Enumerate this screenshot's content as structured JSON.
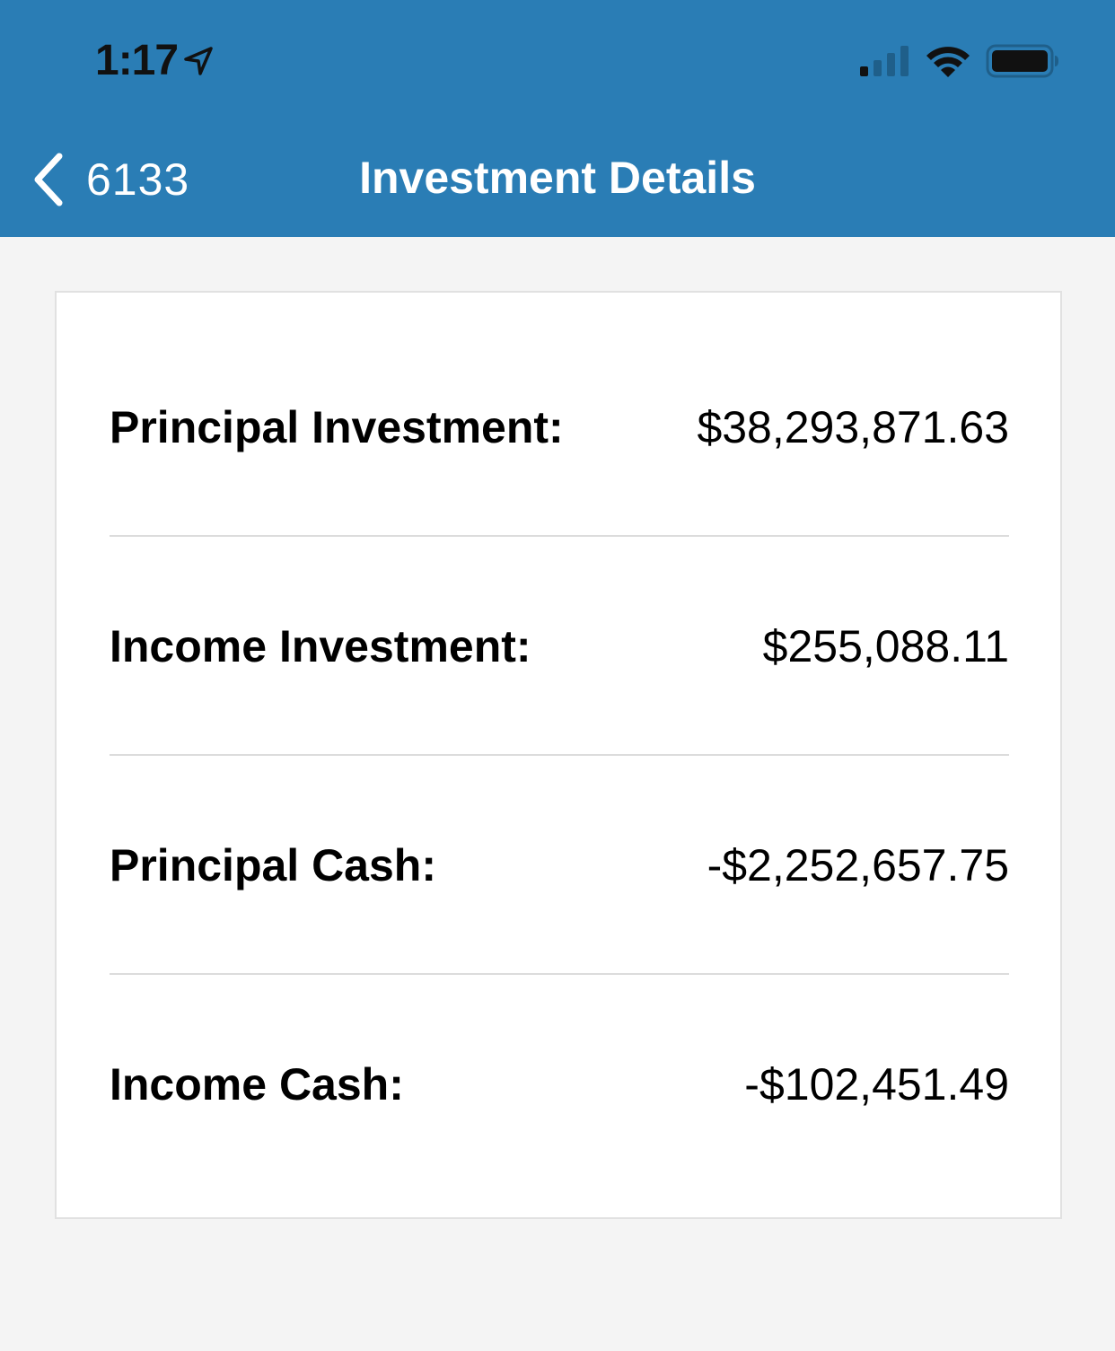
{
  "status_bar": {
    "time": "1:17",
    "icons": [
      "location-arrow-icon",
      "cellular-signal-icon",
      "wifi-icon",
      "battery-icon"
    ]
  },
  "nav": {
    "back_label": "6133",
    "title": "Investment Details",
    "background_color": "#2a7db5"
  },
  "details": [
    {
      "label": "Principal Investment:",
      "value": "$38,293,871.63"
    },
    {
      "label": "Income Investment:",
      "value": "$255,088.11"
    },
    {
      "label": "Principal Cash:",
      "value": "-$2,252,657.75"
    },
    {
      "label": "Income Cash:",
      "value": "-$102,451.49"
    }
  ]
}
